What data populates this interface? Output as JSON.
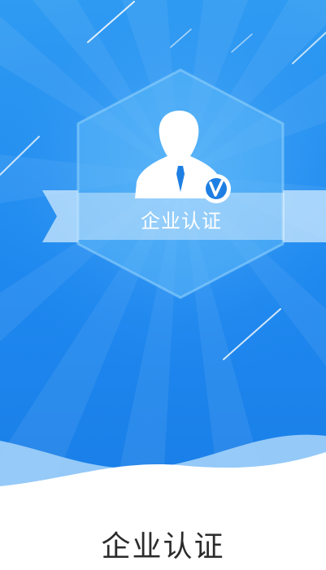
{
  "hero": {
    "badge_label": "企业认证",
    "verified_mark": "v"
  },
  "page": {
    "title": "企业认证"
  },
  "colors": {
    "hero_top": "#2f9bf2",
    "hero_bottom": "#1a7fe8",
    "badge_fill": "#5db8f7",
    "white": "#ffffff",
    "title_text": "#2b2b2b"
  },
  "icons": [
    "person-silhouette-icon",
    "verified-v-icon",
    "shooting-star-decoration"
  ]
}
